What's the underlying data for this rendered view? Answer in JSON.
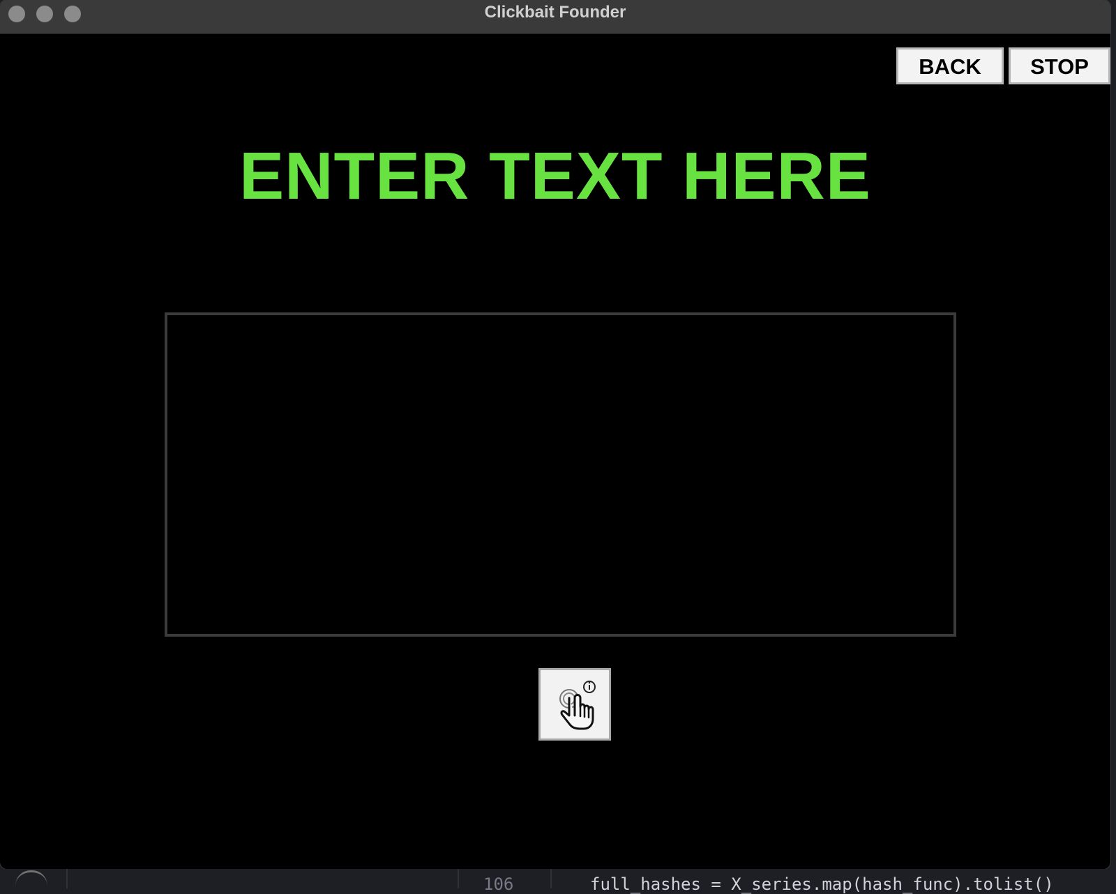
{
  "window": {
    "title": "Clickbait Founder"
  },
  "toolbar": {
    "back_label": "BACK",
    "stop_label": "STOP"
  },
  "main": {
    "prompt_title": "ENTER TEXT HERE",
    "text_input_value": ""
  },
  "controls": {
    "touch_info_icon": "touch-info-icon"
  },
  "background_editor": {
    "line_number": "106",
    "code_line": "full_hashes = X_series.map(hash_func).tolist()"
  },
  "colors": {
    "title_green": "#68e241",
    "window_background": "#000000",
    "titlebar": "#3a3a3a"
  }
}
